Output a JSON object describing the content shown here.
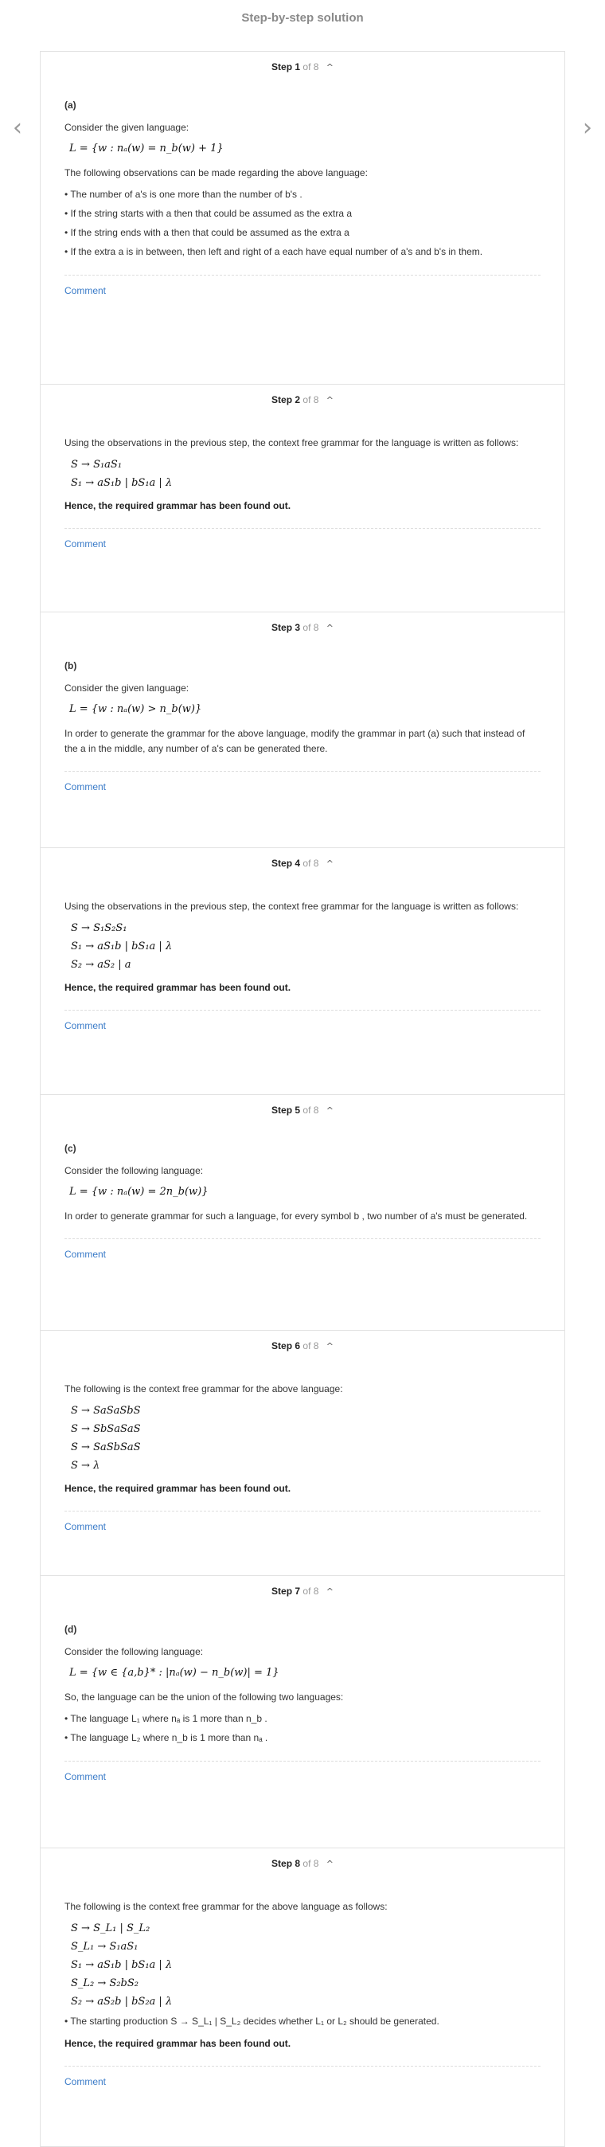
{
  "page_title": "Step-by-step solution",
  "nav": {
    "prev_glyph": "‹",
    "next_glyph": "›"
  },
  "comment_label": "Comment",
  "steps": [
    {
      "num": "Step 1",
      "of": "of 8",
      "part": "(a)",
      "intro": "Consider the given language:",
      "lang": "L = {w : nₐ(w) = n_b(w) + 1}",
      "obs": "The following observations can be made regarding the above language:",
      "bullets": [
        "• The number of  a's  is one more than the number of  b's .",
        "• If the string starts with  a  then that could be assumed as the extra  a",
        "• If the string ends with  a  then that could be assumed as the extra  a",
        "• If the extra  a  is in between, then left and right of  a  each have equal number of  a's  and  b's  in them."
      ]
    },
    {
      "num": "Step 2",
      "of": "of 8",
      "intro": "Using the observations in the previous step, the context free grammar for the language is written as follows:",
      "lines": [
        "S → S₁aS₁",
        "S₁ → aS₁b | bS₁a | λ"
      ],
      "conclusion": "Hence, the required grammar has been found out."
    },
    {
      "num": "Step 3",
      "of": "of 8",
      "part": "(b)",
      "intro": "Consider the given language:",
      "lang": "L = {w : nₐ(w) > n_b(w)}",
      "text": "In order to generate the grammar for the above language, modify the grammar in part (a) such that instead of the  a  in the middle, any number of  a's  can be generated there."
    },
    {
      "num": "Step 4",
      "of": "of 8",
      "intro": "Using the observations in the previous step, the context free grammar for the language is written as follows:",
      "lines": [
        "S → S₁S₂S₁",
        "S₁ → aS₁b | bS₁a | λ",
        "S₂ → aS₂ | a"
      ],
      "conclusion": "Hence, the required grammar has been found out."
    },
    {
      "num": "Step 5",
      "of": "of 8",
      "part": "(c)",
      "intro": "Consider the following language:",
      "lang": "L = {w : nₐ(w) = 2n_b(w)}",
      "text": "In order to generate grammar for such a language, for every symbol  b , two number of  a's  must be generated."
    },
    {
      "num": "Step 6",
      "of": "of 8",
      "intro": "The following is the context free grammar for the above language:",
      "lines": [
        "S → SaSaSbS",
        "S → SbSaSaS",
        "S → SaSbSaS",
        "S → λ"
      ],
      "conclusion": "Hence, the required grammar has been found out."
    },
    {
      "num": "Step 7",
      "of": "of 8",
      "part": "(d)",
      "intro": "Consider the following language:",
      "lang": "L = {w ∈ {a,b}* : |nₐ(w) − n_b(w)| = 1}",
      "text": "So, the language can be the union of the following two languages:",
      "bullets": [
        "• The language  L₁  where  nₐ  is 1 more than  n_b .",
        "• The language  L₂  where  n_b  is 1 more than  nₐ ."
      ]
    },
    {
      "num": "Step 8",
      "of": "of 8",
      "intro": "The following is the context free grammar for the above language as follows:",
      "lines": [
        "S → S_L₁ | S_L₂",
        "S_L₁ → S₁aS₁",
        "S₁ → aS₁b | bS₁a | λ",
        "S_L₂ → S₂bS₂",
        "S₂ → aS₂b | bS₂a | λ"
      ],
      "note": "• The starting production  S → S_L₁ | S_L₂  decides whether  L₁  or  L₂  should be generated.",
      "conclusion": "Hence, the required grammar has been found out."
    }
  ]
}
